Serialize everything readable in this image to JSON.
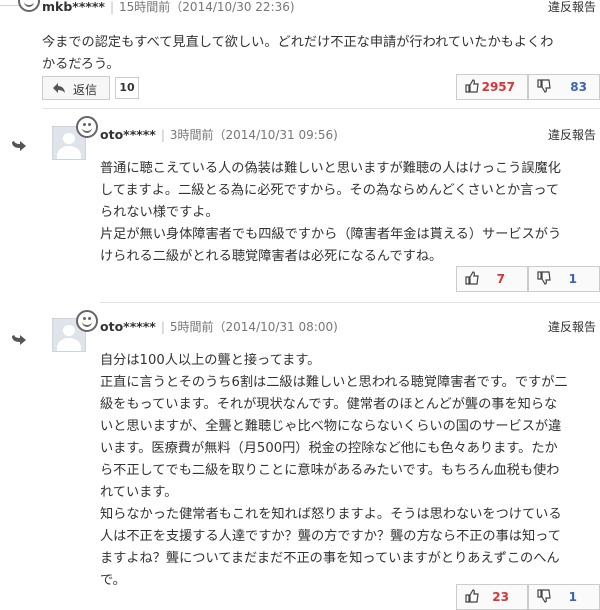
{
  "report_label": "違反報告",
  "comments": [
    {
      "user": "mkb*****",
      "time": "15時間前（2014/10/30 22:36)",
      "lines": [
        "今までの認定もすべて見直して欲しい。どれだけ不正な申請が行われていたかもよくわ",
        "かるだろう。"
      ],
      "reply_label": "返信",
      "reply_count": "10",
      "likes": "2957",
      "dislikes": "83"
    },
    {
      "user": "oto*****",
      "time": "3時間前（2014/10/31 09:56)",
      "lines": [
        "普通に聴こえている人の偽装は難しいと思いますが難聴の人はけっこう誤魔化",
        "してますよ。二級とる為に必死ですから。その為ならめんどくさいとか言って",
        "られない様ですよ。",
        "片足が無い身体障害者でも四級ですから（障害者年金は貰える）サービスがう",
        "けられる二級がとれる聴覚障害者は必死になるんですね。"
      ],
      "likes": "7",
      "dislikes": "1"
    },
    {
      "user": "oto*****",
      "time": "5時間前（2014/10/31 08:00)",
      "lines": [
        "自分は100人以上の聾と接ってます。",
        "正直に言うとそのうち6割は二級は難しいと思われる聴覚障害者です。ですが二",
        "級をもっています。それが現状なんです。健常者のほとんどが聾の事を知らな",
        "いと思いますが、全聾と難聴じゃ比べ物にならないくらいの国のサービスが違",
        "います。医療費が無料（月500円）税金の控除など他にも色々あります。たか",
        "ら不正してでも二級を取りことに意味があるみたいです。もちろん血税も使わ",
        "れています。",
        "知らなかった健常者もこれを知れば怒りますよ。そうは思わないをつけている",
        "人は不正を支援する人達ですか？聾の方ですか？聾の方なら不正の事は知って",
        "ますよね？聾についてまだまだ不正の事を知っていますがとりあえずこのへん",
        "で。"
      ],
      "likes": "23",
      "dislikes": "1"
    }
  ]
}
